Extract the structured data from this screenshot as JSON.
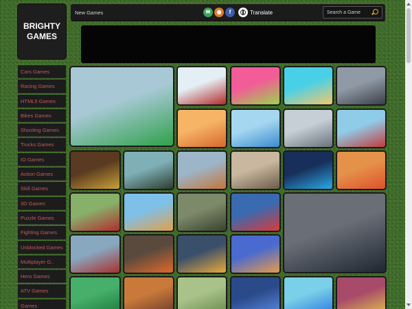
{
  "brand": {
    "logo_text": "BRIGHTY GAMES"
  },
  "topbar": {
    "new_games": "New Games",
    "translate": "Translate",
    "search_placeholder": "Search a Game",
    "share_icons": [
      {
        "name": "email-icon",
        "glyph": "✉",
        "color": "#3ca35a"
      },
      {
        "name": "rss-icon",
        "glyph": "◉",
        "color": "#e07a22"
      },
      {
        "name": "facebook-icon",
        "glyph": "f",
        "color": "#3b5fa6"
      }
    ]
  },
  "sidebar": {
    "categories": [
      "Cars Games",
      "Racing Games",
      "HTML5 Games",
      "Bikes Games",
      "Shooting Games",
      "Trucks Games",
      "IO Games",
      "Action Games",
      "Skill Games",
      "3D Games",
      "Puzzle Games",
      "Fighting Games",
      "Unblocked Games",
      "Multiplayer G..",
      "Hero Games",
      "ATV Games",
      "Games"
    ]
  },
  "games": [
    {
      "name": "stunt-car-ramp-game",
      "colors": [
        "#a7c8d4",
        "#2fa14a"
      ]
    },
    {
      "name": "moto-trial-game",
      "colors": [
        "#e3eff4",
        "#b52a2a"
      ]
    },
    {
      "name": "cut-the-rope-game",
      "colors": [
        "#f25c97",
        "#9ad44a"
      ]
    },
    {
      "name": "ice-cream-game",
      "colors": [
        "#48d0e8",
        "#f2c86c"
      ]
    },
    {
      "name": "drift-car-game",
      "colors": [
        "#8f9aa6",
        "#3b3f47"
      ]
    },
    {
      "name": "pizza-maker-game",
      "colors": [
        "#f5b466",
        "#d8672e"
      ]
    },
    {
      "name": "penguin-runner-game",
      "colors": [
        "#a6d7f0",
        "#3a8bd0"
      ]
    },
    {
      "name": "winter-drift-game",
      "colors": [
        "#c6ced6",
        "#6a727c"
      ]
    },
    {
      "name": "bmx-stunt-game",
      "colors": [
        "#8fcce8",
        "#c43b3b"
      ]
    },
    {
      "name": "offroad-island-game",
      "colors": [
        "#5a3a20",
        "#c9a03a"
      ]
    },
    {
      "name": "monster-truck-game",
      "colors": [
        "#7fb0b8",
        "#2e3d2e"
      ]
    },
    {
      "name": "race-track-game",
      "colors": [
        "#9db5c9",
        "#c4753a"
      ]
    },
    {
      "name": "city-shooter-game",
      "colors": [
        "#c9b89f",
        "#6b5c4a"
      ]
    },
    {
      "name": "block-jump-game",
      "colors": [
        "#172f5a",
        "#2aa8e6"
      ]
    },
    {
      "name": "sports-car-game",
      "colors": [
        "#e4914a",
        "#e0502a"
      ]
    },
    {
      "name": "classic-car-game",
      "colors": [
        "#87b06a",
        "#b32d2d"
      ]
    },
    {
      "name": "kart-climb-game",
      "colors": [
        "#7ec0e8",
        "#e3a04a"
      ]
    },
    {
      "name": "army-battle-game",
      "colors": [
        "#7d8a6a",
        "#3a4330"
      ]
    },
    {
      "name": "soccer-star-game",
      "colors": [
        "#3a6ab0",
        "#d83a3a"
      ]
    },
    {
      "name": "moto-race-game",
      "colors": [
        "#6a6f77",
        "#1f2732"
      ]
    },
    {
      "name": "big-truck-game",
      "colors": [
        "#88a8c0",
        "#a8302e"
      ]
    },
    {
      "name": "orange-car-game",
      "colors": [
        "#5a4a3e",
        "#e0682a"
      ]
    },
    {
      "name": "race-cars-game",
      "colors": [
        "#3a4f6a",
        "#e8a83a"
      ]
    },
    {
      "name": "cat-word-game",
      "colors": [
        "#4a6ad0",
        "#e69a4a"
      ]
    },
    {
      "name": "tower-stunt-game",
      "colors": [
        "#46b06a",
        "#1f7a3e"
      ]
    },
    {
      "name": "princess-dressup-game",
      "colors": [
        "#c97a3a",
        "#6a3a2a"
      ]
    },
    {
      "name": "scooter-run-game",
      "colors": [
        "#a9c28a",
        "#6a8a4a"
      ]
    },
    {
      "name": "police-car-game",
      "colors": [
        "#2a4a8a",
        "#5a8ae0"
      ]
    },
    {
      "name": "blue-car-game",
      "colors": [
        "#7ad0e8",
        "#2a7ae0"
      ]
    },
    {
      "name": "pinball-game",
      "colors": [
        "#a84a6a",
        "#e0c04a"
      ]
    }
  ]
}
